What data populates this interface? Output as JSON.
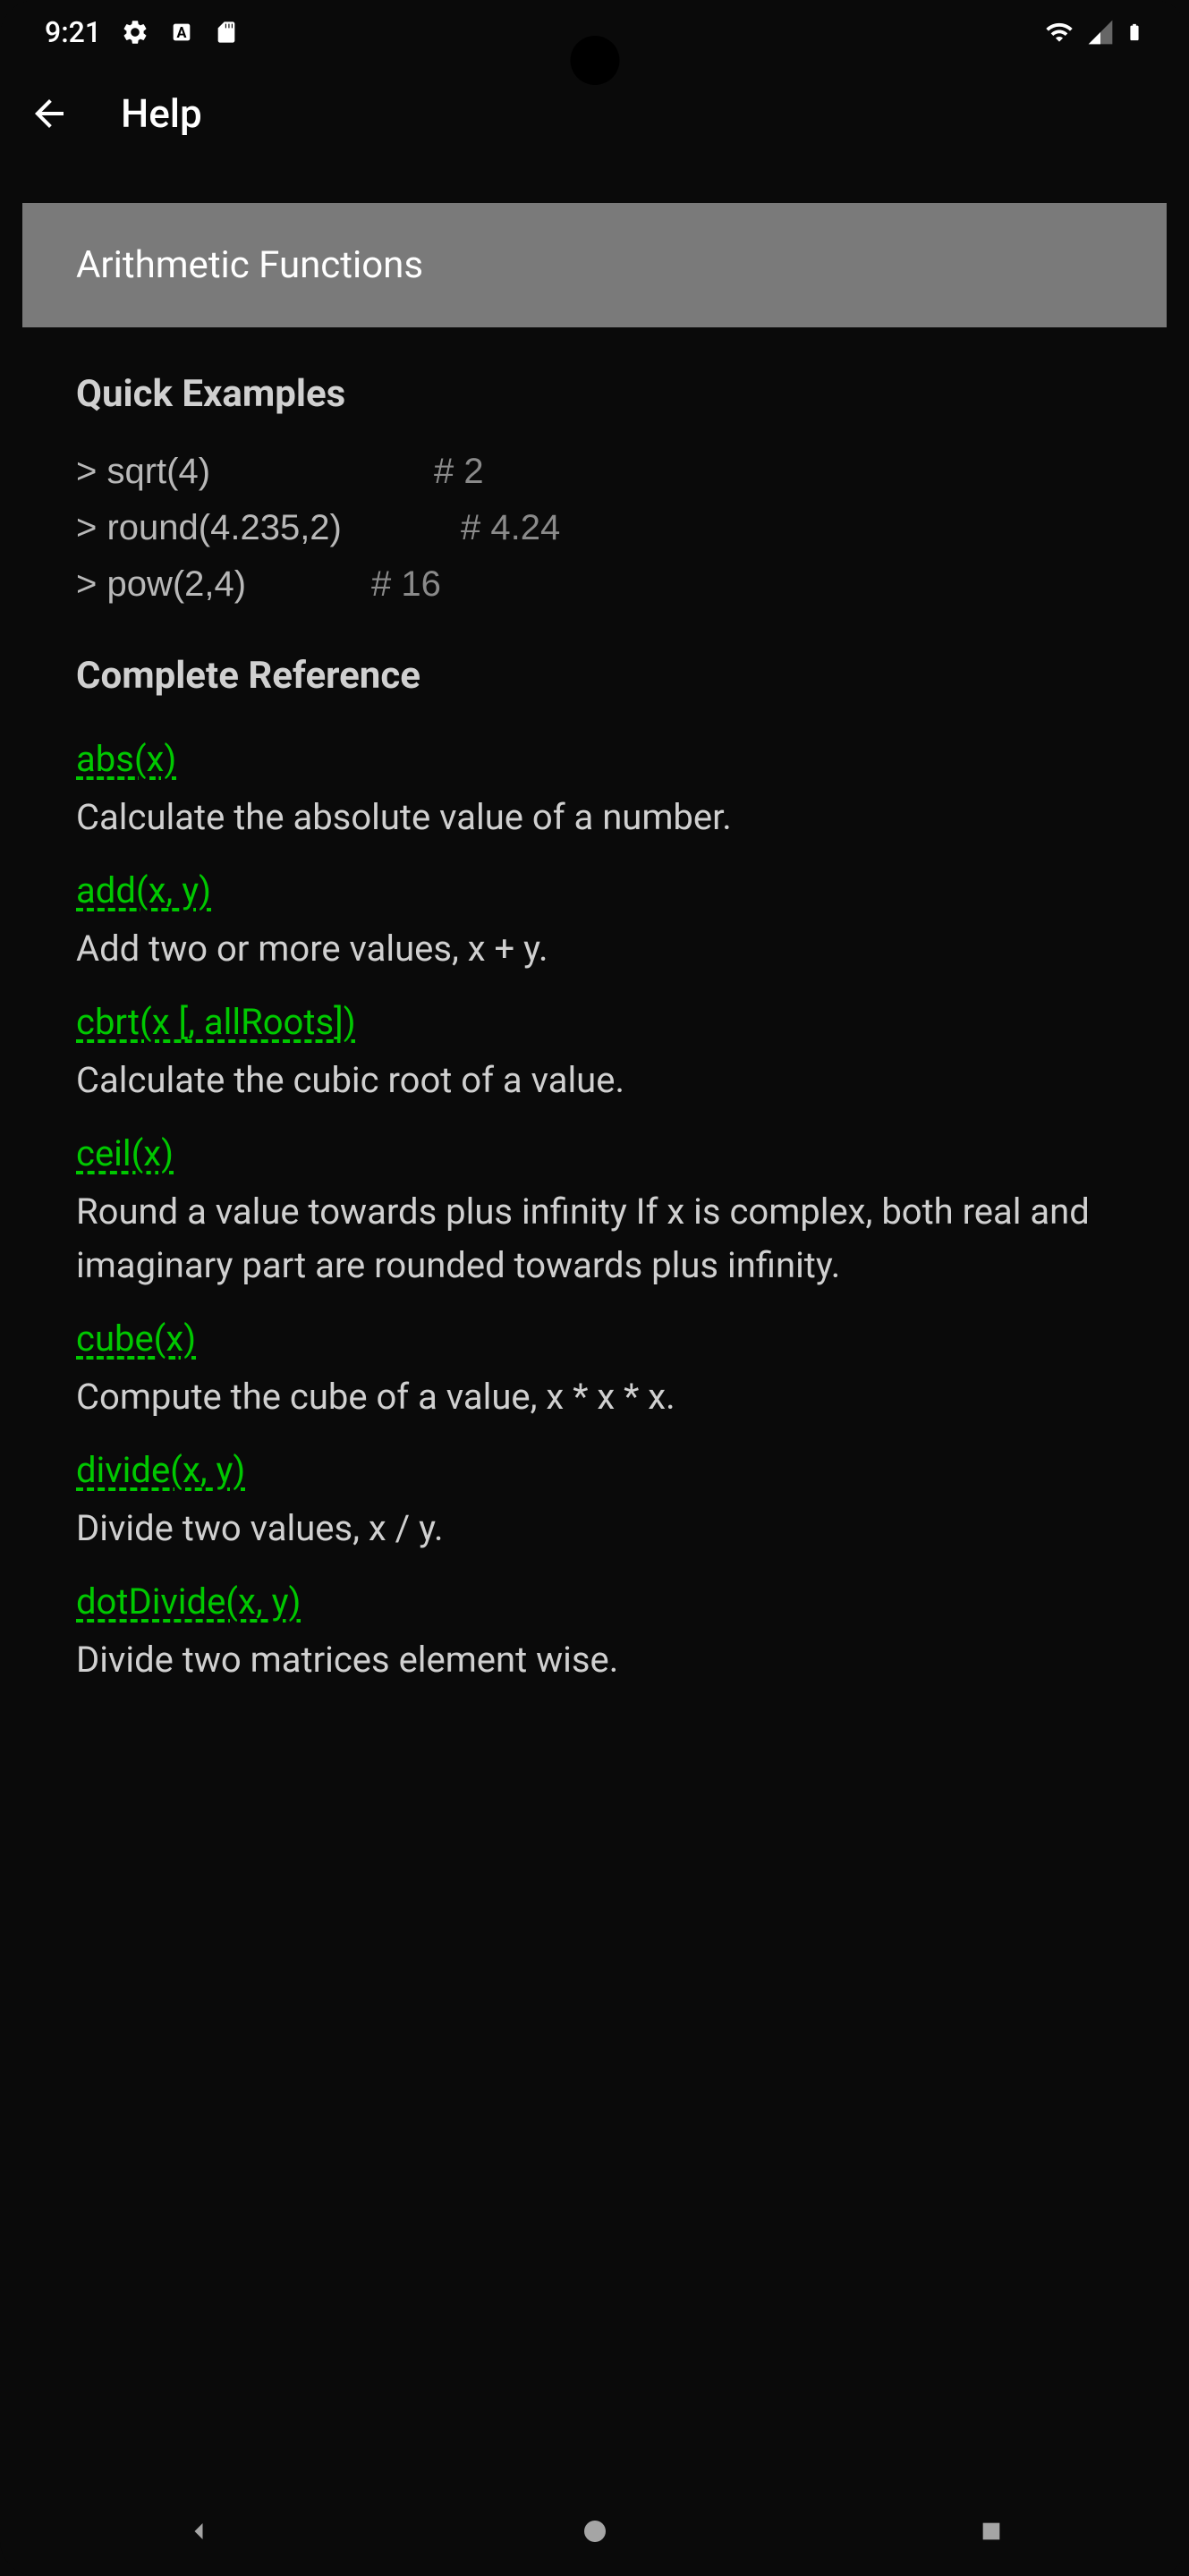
{
  "statusBar": {
    "time": "9:21"
  },
  "appBar": {
    "title": "Help"
  },
  "sectionHeader": "Arithmetic Functions",
  "quickExamples": {
    "title": "Quick Examples",
    "items": [
      {
        "prompt": "> sqrt(4)",
        "result": "# 2"
      },
      {
        "prompt": "> round(4.235,2)",
        "result": "# 4.24"
      },
      {
        "prompt": "> pow(2,4)",
        "result": "# 16"
      }
    ]
  },
  "completeReference": {
    "title": "Complete Reference",
    "items": [
      {
        "name": "abs(x)",
        "description": "Calculate the absolute value of a number."
      },
      {
        "name": "add(x, y)",
        "description": "Add two or more values, x + y."
      },
      {
        "name": "cbrt(x [, allRoots])",
        "description": "Calculate the cubic root of a value."
      },
      {
        "name": "ceil(x)",
        "description": "Round a value towards plus infinity If x is complex, both real and imaginary part are rounded towards plus infinity."
      },
      {
        "name": "cube(x)",
        "description": "Compute the cube of a value, x * x * x."
      },
      {
        "name": "divide(x, y)",
        "description": "Divide two values, x / y."
      },
      {
        "name": "dotDivide(x, y)",
        "description": "Divide two matrices element wise."
      }
    ]
  }
}
